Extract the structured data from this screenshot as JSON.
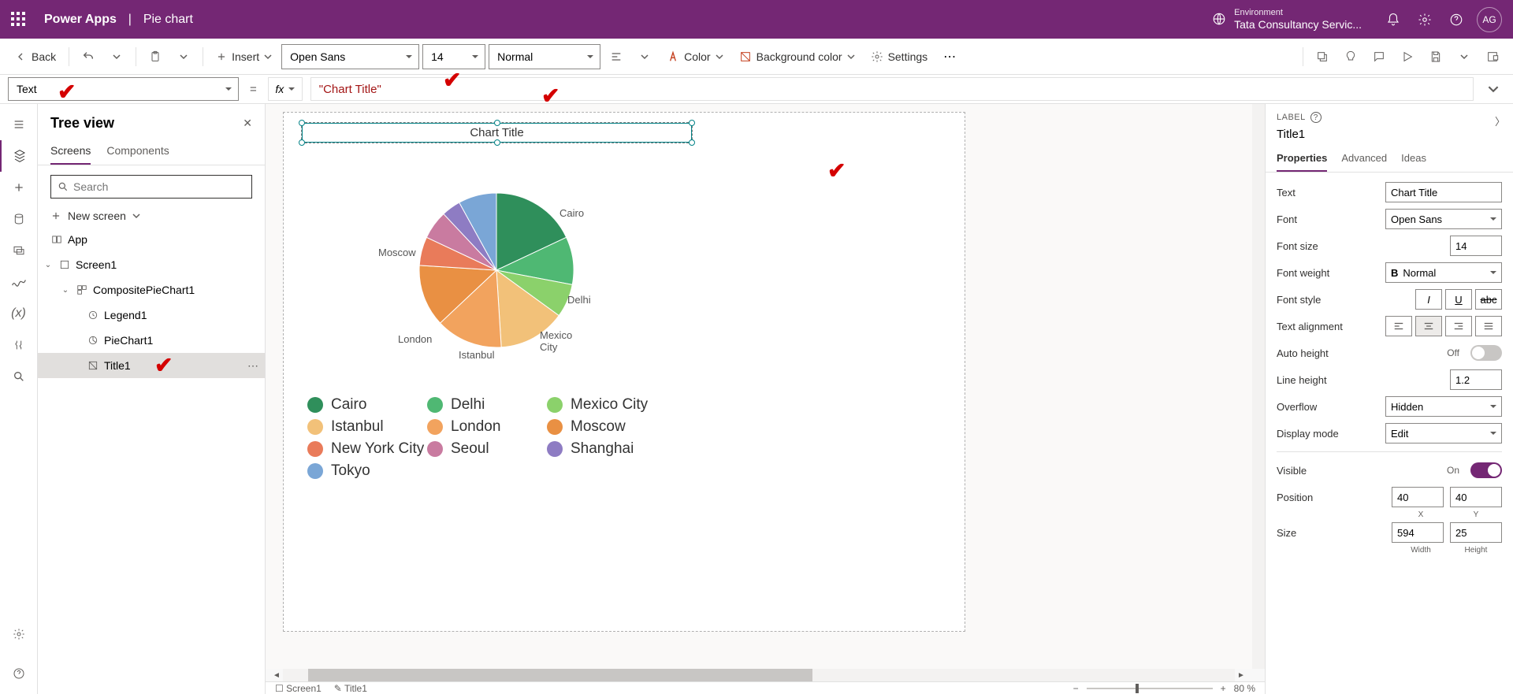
{
  "header": {
    "app": "Power Apps",
    "page": "Pie chart",
    "env_label": "Environment",
    "env_name": "Tata Consultancy Servic...",
    "avatar": "AG"
  },
  "toolbar": {
    "back": "Back",
    "insert": "Insert",
    "font": "Open Sans",
    "size": "14",
    "weight": "Normal",
    "color": "Color",
    "bgcolor": "Background color",
    "settings": "Settings"
  },
  "formula": {
    "property": "Text",
    "value": "\"Chart Title\""
  },
  "tree": {
    "title": "Tree view",
    "tab_screens": "Screens",
    "tab_components": "Components",
    "search_placeholder": "Search",
    "new_screen": "New screen",
    "app": "App",
    "screen": "Screen1",
    "composite": "CompositePieChart1",
    "legend": "Legend1",
    "piechart": "PieChart1",
    "title1": "Title1"
  },
  "canvas": {
    "chart_title": "Chart Title"
  },
  "chart_data": {
    "type": "pie",
    "title": "Chart Title",
    "series": [
      {
        "name": "Cairo",
        "value": 18,
        "color": "#2f8f5b"
      },
      {
        "name": "Delhi",
        "value": 10,
        "color": "#4fb873"
      },
      {
        "name": "Mexico City",
        "value": 7,
        "color": "#8bd16b"
      },
      {
        "name": "Istanbul",
        "value": 14,
        "color": "#f2c179"
      },
      {
        "name": "London",
        "value": 14,
        "color": "#f2a35e"
      },
      {
        "name": "Moscow",
        "value": 13,
        "color": "#e99043"
      },
      {
        "name": "New York City",
        "value": 6,
        "color": "#e97b5a"
      },
      {
        "name": "Seoul",
        "value": 6,
        "color": "#c97ba0"
      },
      {
        "name": "Shanghai",
        "value": 4,
        "color": "#8e7cc3"
      },
      {
        "name": "Tokyo",
        "value": 8,
        "color": "#7aa6d6"
      }
    ],
    "legend_position": "bottom",
    "legend_columns": 3
  },
  "props": {
    "type": "LABEL",
    "name": "Title1",
    "tab_properties": "Properties",
    "tab_advanced": "Advanced",
    "tab_ideas": "Ideas",
    "text_label": "Text",
    "text_value": "Chart Title",
    "font_label": "Font",
    "font_value": "Open Sans",
    "fontsize_label": "Font size",
    "fontsize_value": "14",
    "fontweight_label": "Font weight",
    "fontweight_value": "Normal",
    "fontstyle_label": "Font style",
    "align_label": "Text alignment",
    "autoheight_label": "Auto height",
    "autoheight_state": "Off",
    "lineheight_label": "Line height",
    "lineheight_value": "1.2",
    "overflow_label": "Overflow",
    "overflow_value": "Hidden",
    "displaymode_label": "Display mode",
    "displaymode_value": "Edit",
    "visible_label": "Visible",
    "visible_state": "On",
    "position_label": "Position",
    "pos_x": "40",
    "pos_y": "40",
    "x_label": "X",
    "y_label": "Y",
    "size_label": "Size",
    "width": "594",
    "height": "25",
    "w_label": "Width",
    "h_label": "Height"
  },
  "footer": {
    "screen": "Screen1",
    "element": "Title1",
    "zoom": "80  %"
  }
}
